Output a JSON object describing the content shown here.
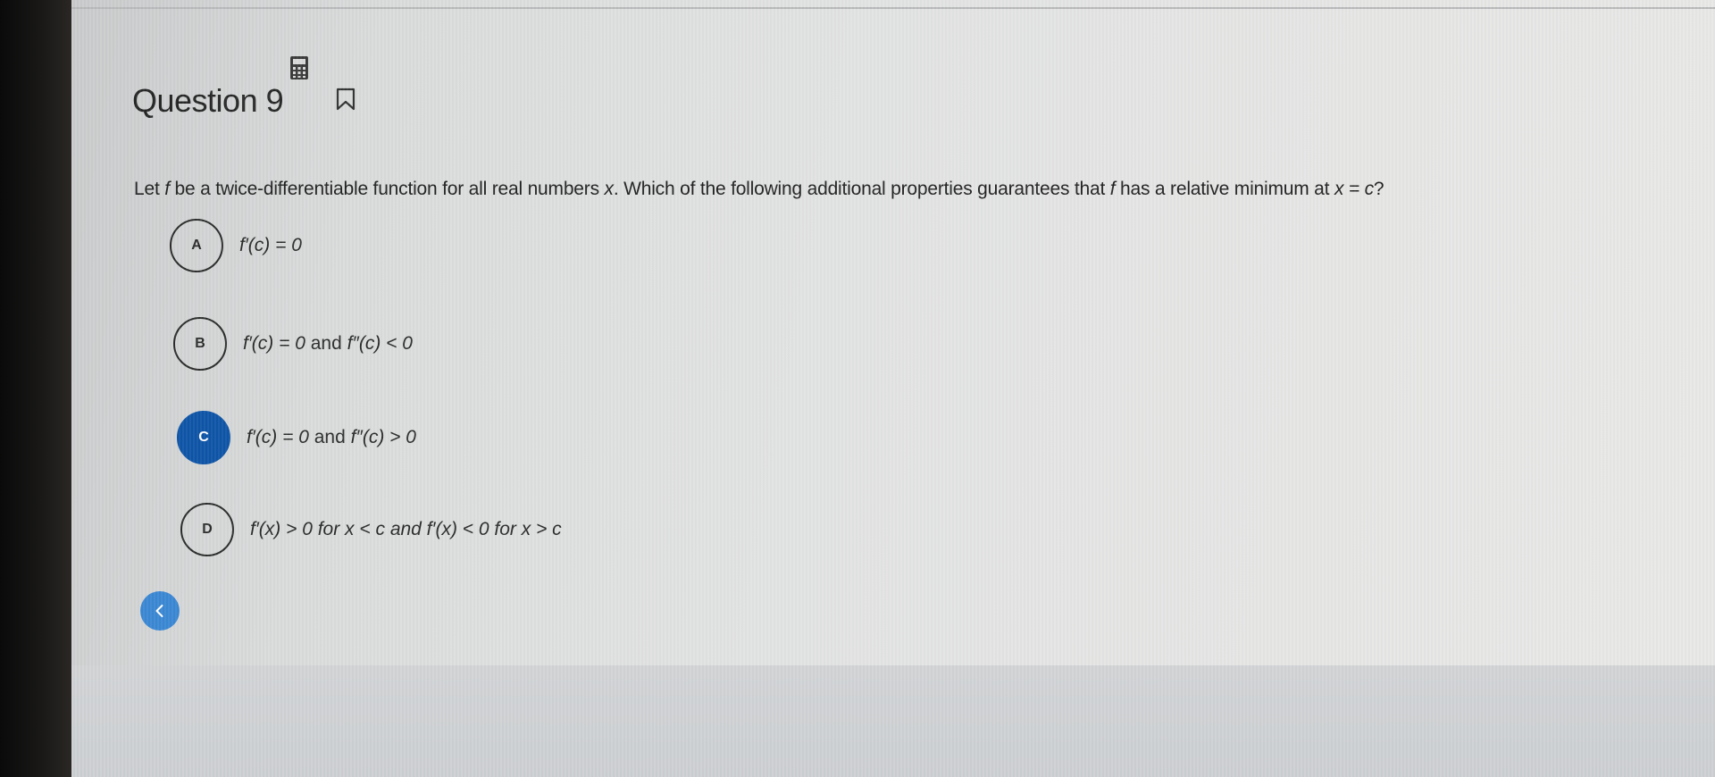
{
  "question": {
    "title": "Question 9",
    "text_intro": "Let ",
    "text_f1": "f",
    "text_mid1": " be a twice-differentiable function for all real numbers ",
    "text_x": "x",
    "text_mid2": ". Which of the following additional properties guarantees that ",
    "text_f2": "f",
    "text_mid3": " has a relative minimum at ",
    "text_eq": "x = c",
    "text_end": "?"
  },
  "icons": {
    "calculator": "calculator-icon",
    "bookmark": "bookmark-icon",
    "back": "chevron-left-icon"
  },
  "options": [
    {
      "letter": "A",
      "text": "f′(c) = 0",
      "selected": false
    },
    {
      "letter": "B",
      "text_a": "f′(c) = 0",
      "join": " and ",
      "text_b": "f″(c) < 0",
      "selected": false
    },
    {
      "letter": "C",
      "text_a": "f′(c) = 0",
      "join": " and ",
      "text_b": "f″(c) > 0",
      "selected": true
    },
    {
      "letter": "D",
      "text": "f′(x) > 0 for x < c and f′(x) < 0 for x > c",
      "selected": false
    }
  ],
  "colors": {
    "selected": "#0f55a8",
    "back_button": "#3b88d4"
  }
}
